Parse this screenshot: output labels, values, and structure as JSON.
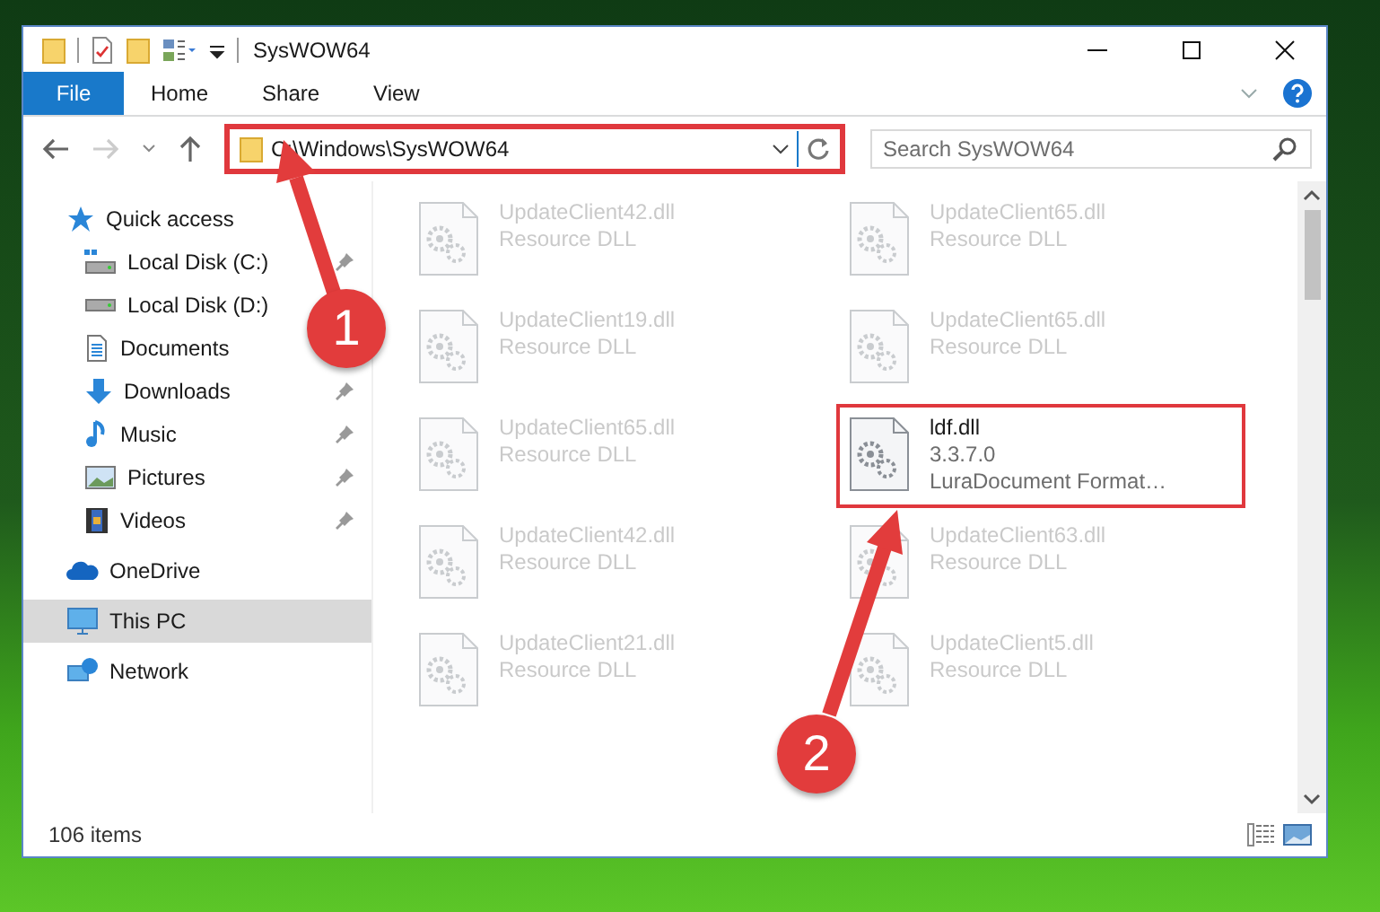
{
  "window": {
    "title": "SysWOW64"
  },
  "ribbon": {
    "tabs": [
      {
        "label": "File",
        "kind": "menu",
        "selected": false
      },
      {
        "label": "Home",
        "kind": "tab",
        "selected": false
      },
      {
        "label": "Share",
        "kind": "tab",
        "selected": false
      },
      {
        "label": "View",
        "kind": "tab",
        "selected": false
      }
    ]
  },
  "navigation": {
    "forward_disabled": true
  },
  "address_bar": {
    "path": "C:\\Windows\\SysWOW64",
    "highlighted": true
  },
  "search": {
    "placeholder": "Search SysWOW64"
  },
  "sidebar": {
    "items": [
      {
        "label": "Quick access",
        "selected": false,
        "children": [
          {
            "label": "Local Disk (C:)",
            "pinned": true,
            "selected": false
          },
          {
            "label": "Local Disk (D:)",
            "pinned": false,
            "selected": false
          },
          {
            "label": "Documents",
            "pinned": false,
            "selected": false
          },
          {
            "label": "Downloads",
            "pinned": true,
            "selected": false
          },
          {
            "label": "Music",
            "pinned": true,
            "selected": false
          },
          {
            "label": "Pictures",
            "pinned": true,
            "selected": false
          },
          {
            "label": "Videos",
            "pinned": true,
            "selected": false
          }
        ]
      },
      {
        "label": "OneDrive",
        "selected": false
      },
      {
        "label": "This PC",
        "selected": true
      },
      {
        "label": "Network",
        "selected": false
      }
    ]
  },
  "files": [
    {
      "name": "UpdateClient42.dll",
      "details": [
        "Resource DLL"
      ],
      "blurred": true,
      "highlighted": false
    },
    {
      "name": "UpdateClient65.dll",
      "details": [
        "Resource DLL"
      ],
      "blurred": true,
      "highlighted": false
    },
    {
      "name": "UpdateClient19.dll",
      "details": [
        "Resource DLL"
      ],
      "blurred": true,
      "highlighted": false
    },
    {
      "name": "UpdateClient65.dll",
      "details": [
        "Resource DLL"
      ],
      "blurred": true,
      "highlighted": false
    },
    {
      "name": "UpdateClient65.dll",
      "details": [
        "Resource DLL"
      ],
      "blurred": true,
      "highlighted": false
    },
    {
      "name": "ldf.dll",
      "details": [
        "3.3.7.0",
        "LuraDocument Format…"
      ],
      "blurred": false,
      "highlighted": true
    },
    {
      "name": "UpdateClient42.dll",
      "details": [
        "Resource DLL"
      ],
      "blurred": true,
      "highlighted": false
    },
    {
      "name": "UpdateClient63.dll",
      "details": [
        "Resource DLL"
      ],
      "blurred": true,
      "highlighted": false
    },
    {
      "name": "UpdateClient21.dll",
      "details": [
        "Resource DLL"
      ],
      "blurred": true,
      "highlighted": false
    },
    {
      "name": "UpdateClient5.dll",
      "details": [
        "Resource DLL"
      ],
      "blurred": true,
      "highlighted": false
    }
  ],
  "annotations": [
    {
      "label": "1"
    },
    {
      "label": "2"
    }
  ],
  "status_bar": {
    "item_count": "106 items"
  }
}
